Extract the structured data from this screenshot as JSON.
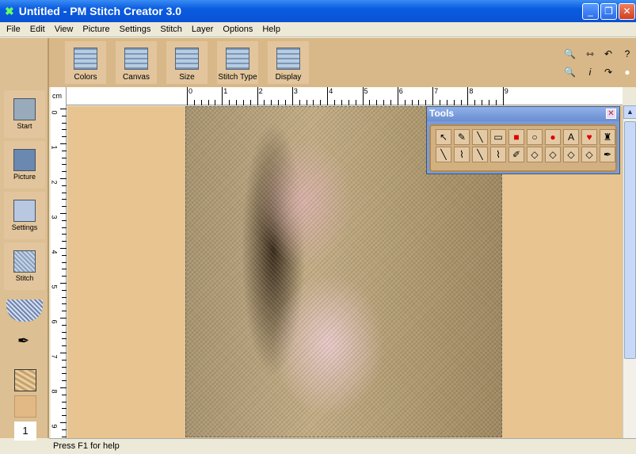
{
  "window": {
    "title": "Untitled - PM Stitch Creator 3.0",
    "min": "_",
    "max": "❐",
    "close": "✕"
  },
  "menu": [
    "File",
    "Edit",
    "View",
    "Picture",
    "Settings",
    "Stitch",
    "Layer",
    "Options",
    "Help"
  ],
  "toolbar": [
    "Colors",
    "Canvas",
    "Size",
    "Stitch Type",
    "Display"
  ],
  "right_icons": [
    "zoom-in-icon",
    "fit-icon",
    "undo-icon",
    "help-icon",
    "zoom-out-icon",
    "info-icon",
    "redo-icon",
    "circle-icon"
  ],
  "sidebar": [
    "Start",
    "Picture",
    "Settings",
    "Stitch"
  ],
  "layer_number": "1",
  "ruler": {
    "unit": "cm",
    "h": [
      "0",
      "1",
      "2",
      "3",
      "4",
      "5",
      "6",
      "7",
      "8",
      "9"
    ],
    "v": [
      "0",
      "1",
      "2",
      "3",
      "4",
      "5",
      "6",
      "7",
      "8",
      "9"
    ]
  },
  "tools_panel": {
    "title": "Tools",
    "close": "✕",
    "row1": [
      "↖",
      "✎",
      "╲",
      "▭",
      "■",
      "○",
      "●",
      "A",
      "♥",
      "♜"
    ],
    "row2": [
      "╲",
      "⌇",
      "╲",
      "⌇",
      "✐",
      "◇",
      "◇",
      "◇",
      "◇",
      "✒"
    ]
  },
  "status": "Press F1 for help"
}
